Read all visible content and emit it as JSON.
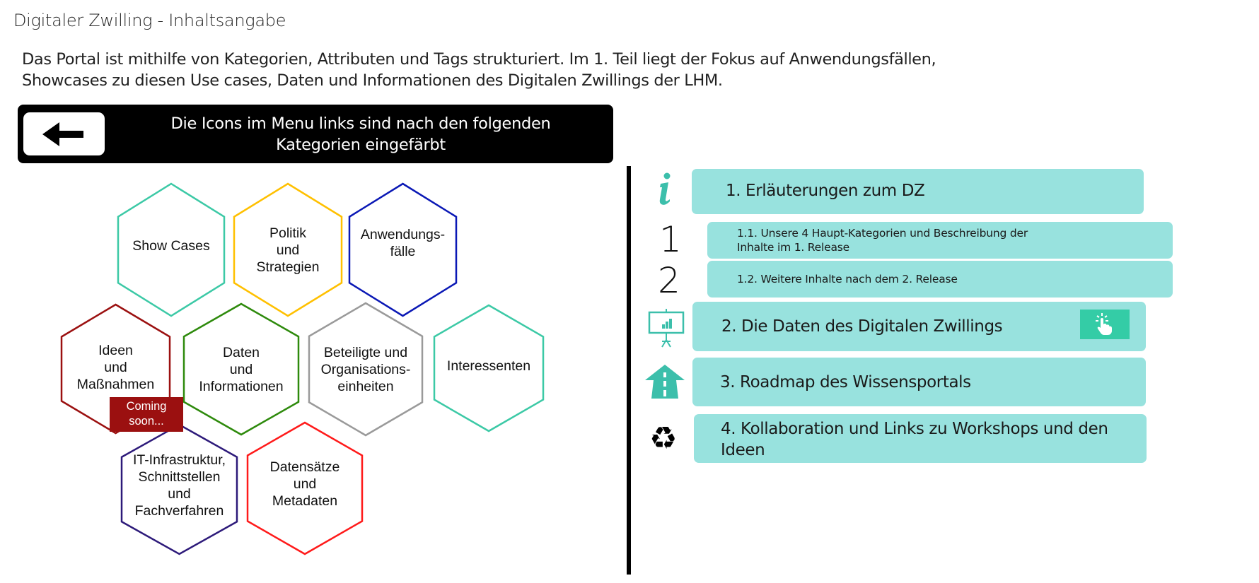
{
  "page": {
    "title": "Digitaler Zwilling - Inhaltsangabe",
    "intro_lines": [
      "Das Portal ist mithilfe von Kategorien, Attributen und Tags strukturiert. Im 1. Teil liegt der Fokus auf Anwendungsfällen,",
      "Showcases zu diesen Use cases, Daten und Informationen des Digitalen Zwillings der LHM."
    ]
  },
  "banner": {
    "back_icon": "arrow-left-icon",
    "lines": [
      "Die Icons im Menu links sind nach den folgenden",
      "Kategorien eingefärbt"
    ]
  },
  "categories": [
    {
      "lines": [
        "Show Cases"
      ],
      "color": "#3cc9a6"
    },
    {
      "lines": [
        "Politik",
        "und",
        "Strategien"
      ],
      "color": "#ffc000"
    },
    {
      "lines": [
        "Anwendungs-",
        "fälle"
      ],
      "color": "#0a18b5"
    },
    {
      "lines": [
        "Ideen",
        "und",
        "Maßnahmen"
      ],
      "color": "#9b1010"
    },
    {
      "lines": [
        "Daten",
        "und",
        "Informationen"
      ],
      "color": "#2e8a0c"
    },
    {
      "lines": [
        "Beteiligte und",
        "Organisations-",
        "einheiten"
      ],
      "color": "#9a9a9a"
    },
    {
      "lines": [
        "Interessenten"
      ],
      "color": "#3cc9a6"
    },
    {
      "lines": [
        "IT-Infrastruktur,",
        "Schnittstellen",
        "und",
        "Fachverfahren"
      ],
      "color": "#2d1a7a"
    },
    {
      "lines": [
        "Datensätze",
        "und",
        "Metadaten"
      ],
      "color": "#ff1a1a"
    }
  ],
  "badge": {
    "lines": [
      "Coming",
      "soon..."
    ],
    "color": "#9b1010"
  },
  "menu": {
    "accent_color": "#98e2de",
    "icon_color": "#3cbfab",
    "items": [
      {
        "label": "1. Erläuterungen zum DZ",
        "icon": "info-icon"
      },
      {
        "label_lines": [
          "1.1. Unsere 4 Haupt-Kategorien und Beschreibung der",
          "Inhalte im 1. Release"
        ],
        "icon_text": "1"
      },
      {
        "label": "1.2. Weitere Inhalte nach dem 2. Release",
        "icon_text": "2"
      },
      {
        "label": "2. Die Daten des Digitalen Zwillings",
        "icon": "presentation-chart-icon",
        "action_icon": "tap-hand-icon",
        "action_color": "#34cca6"
      },
      {
        "label": "3. Roadmap des Wissensportals",
        "icon": "road-arrow-icon"
      },
      {
        "label": "4. Kollaboration und Links zu Workshops und den Ideen",
        "icon": "recycle-icon"
      }
    ]
  }
}
